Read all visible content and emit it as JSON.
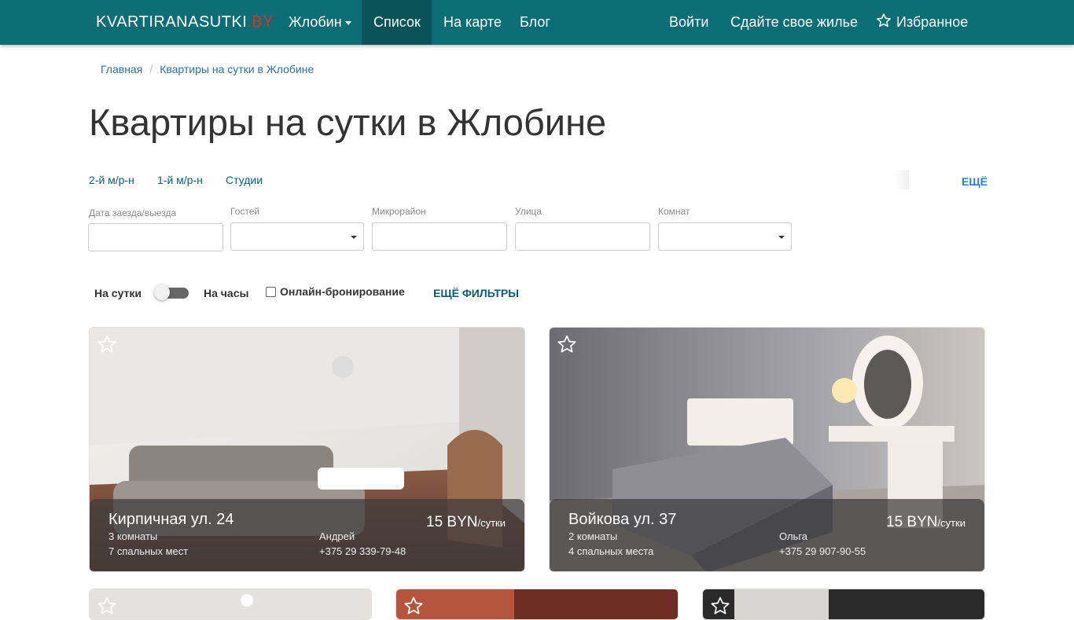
{
  "nav": {
    "brand_main": "KVARTIRANASUTKI",
    "brand_tld": ".BY",
    "city": "Жлобин",
    "list": "Список",
    "map": "На карте",
    "blog": "Блог",
    "login": "Войти",
    "rent_out": "Сдайте свое жилье",
    "favorites": "Избранное"
  },
  "breadcrumb": {
    "home": "Главная",
    "current": "Квартиры на сутки в Жлобине"
  },
  "page_title": "Квартиры на сутки в Жлобине",
  "quick_links": [
    "2-й м/р-н",
    "1-й м/р-н",
    "Студии"
  ],
  "quick_more": "ЕЩЁ",
  "filters": {
    "dates_label": "Дата заезда/выезда",
    "guests_label": "Гостей",
    "district_label": "Микрорайон",
    "street_label": "Улица",
    "rooms_label": "Комнат",
    "per_day": "На сутки",
    "per_hour": "На часы",
    "online_booking": "Онлайн-бронирование",
    "more_filters": "ЕЩЁ ФИЛЬТРЫ"
  },
  "listings": [
    {
      "address": "Кирпичная ул. 24",
      "rooms": "3 комнаты",
      "beds": "7 спальных мест",
      "owner": "Андрей",
      "phone": "+375 29 339-79-48",
      "price": "15 BYN",
      "unit": "/сутки"
    },
    {
      "address": "Войкова ул. 37",
      "rooms": "2 комнаты",
      "beds": "4 спальных места",
      "owner": "Ольга",
      "phone": "+375 29 907-90-55",
      "price": "15 BYN",
      "unit": "/сутки"
    }
  ],
  "icons": {
    "favorite": "star-outline-icon",
    "dropdown": "chevron-down-icon"
  },
  "colors": {
    "navbar": "#0b6e74",
    "navbar_active": "#0a5358",
    "brand_tld": "#e0302a",
    "link": "#2a6fa8"
  }
}
